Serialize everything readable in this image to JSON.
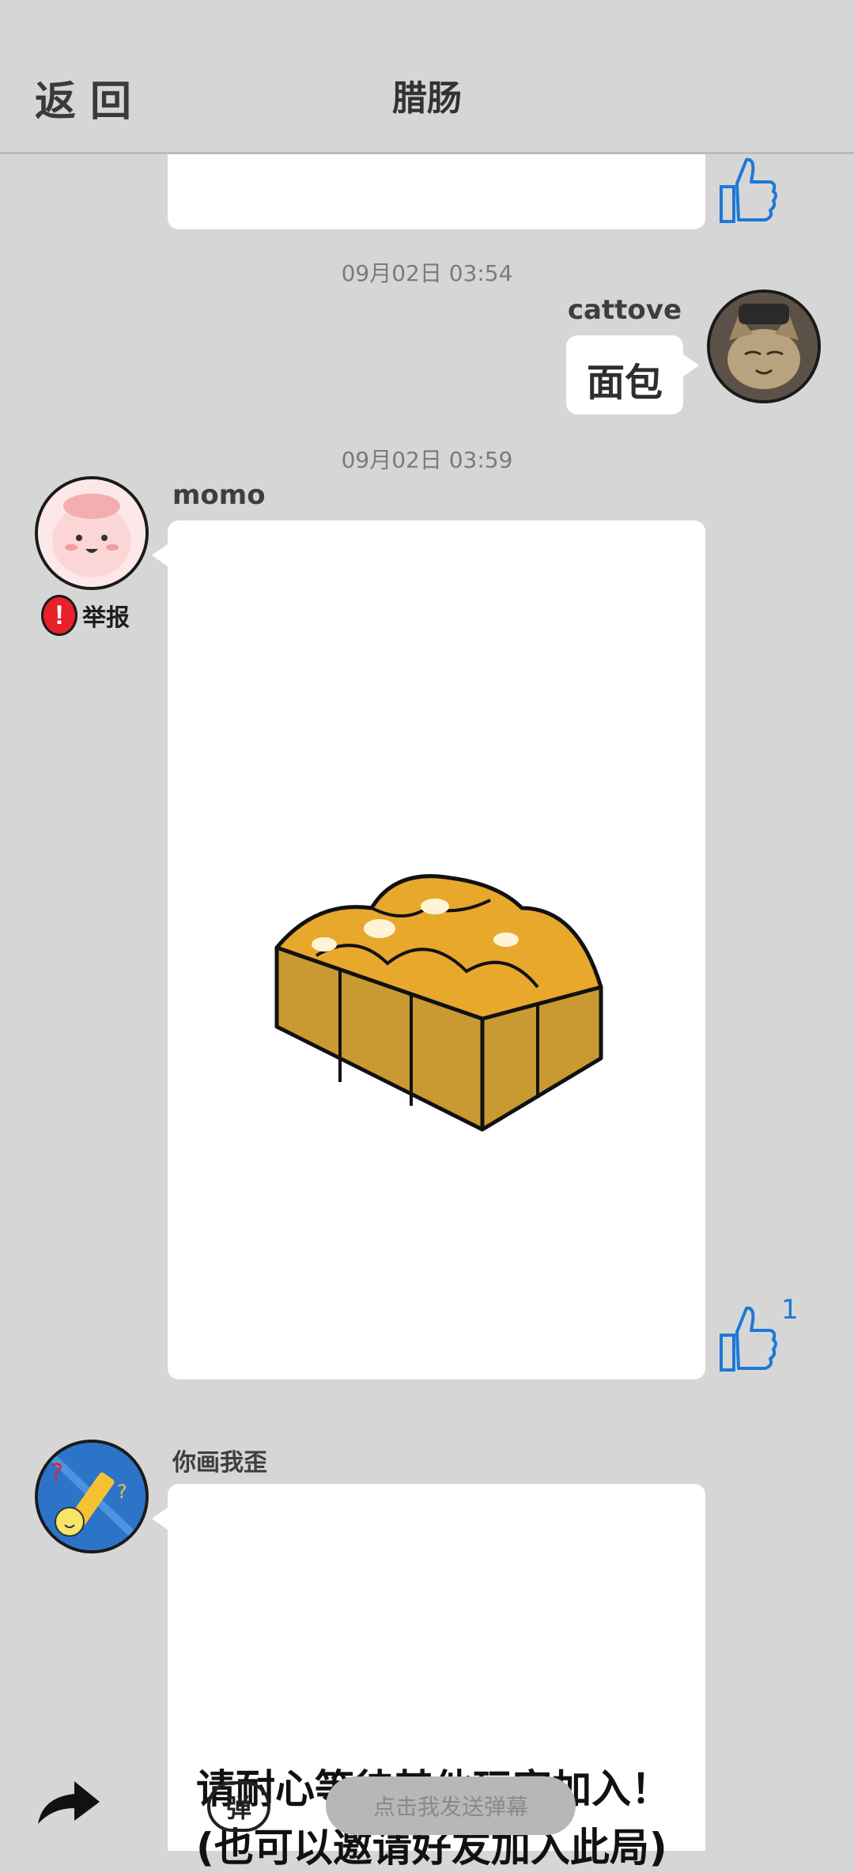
{
  "header": {
    "back_label": "返回",
    "title": "腊肠"
  },
  "messages": [
    {
      "timestamp": "09月02日 03:54",
      "user": "cattove",
      "text": "面包"
    },
    {
      "timestamp": "09月02日 03:59",
      "user": "momo",
      "report_label": "举报",
      "like_count": "1"
    },
    {
      "user": "你画我歪",
      "status_line1": "请耐心等待其他玩家加入！",
      "status_line2": "(也可以邀请好友加入此局)"
    }
  ],
  "bottom": {
    "danmaku_icon_label": "弹",
    "danmaku_placeholder": "点击我发送弹幕"
  },
  "colors": {
    "background": "#d6d6d6",
    "like_blue": "#1e78d8",
    "report_red": "#e8202c"
  }
}
